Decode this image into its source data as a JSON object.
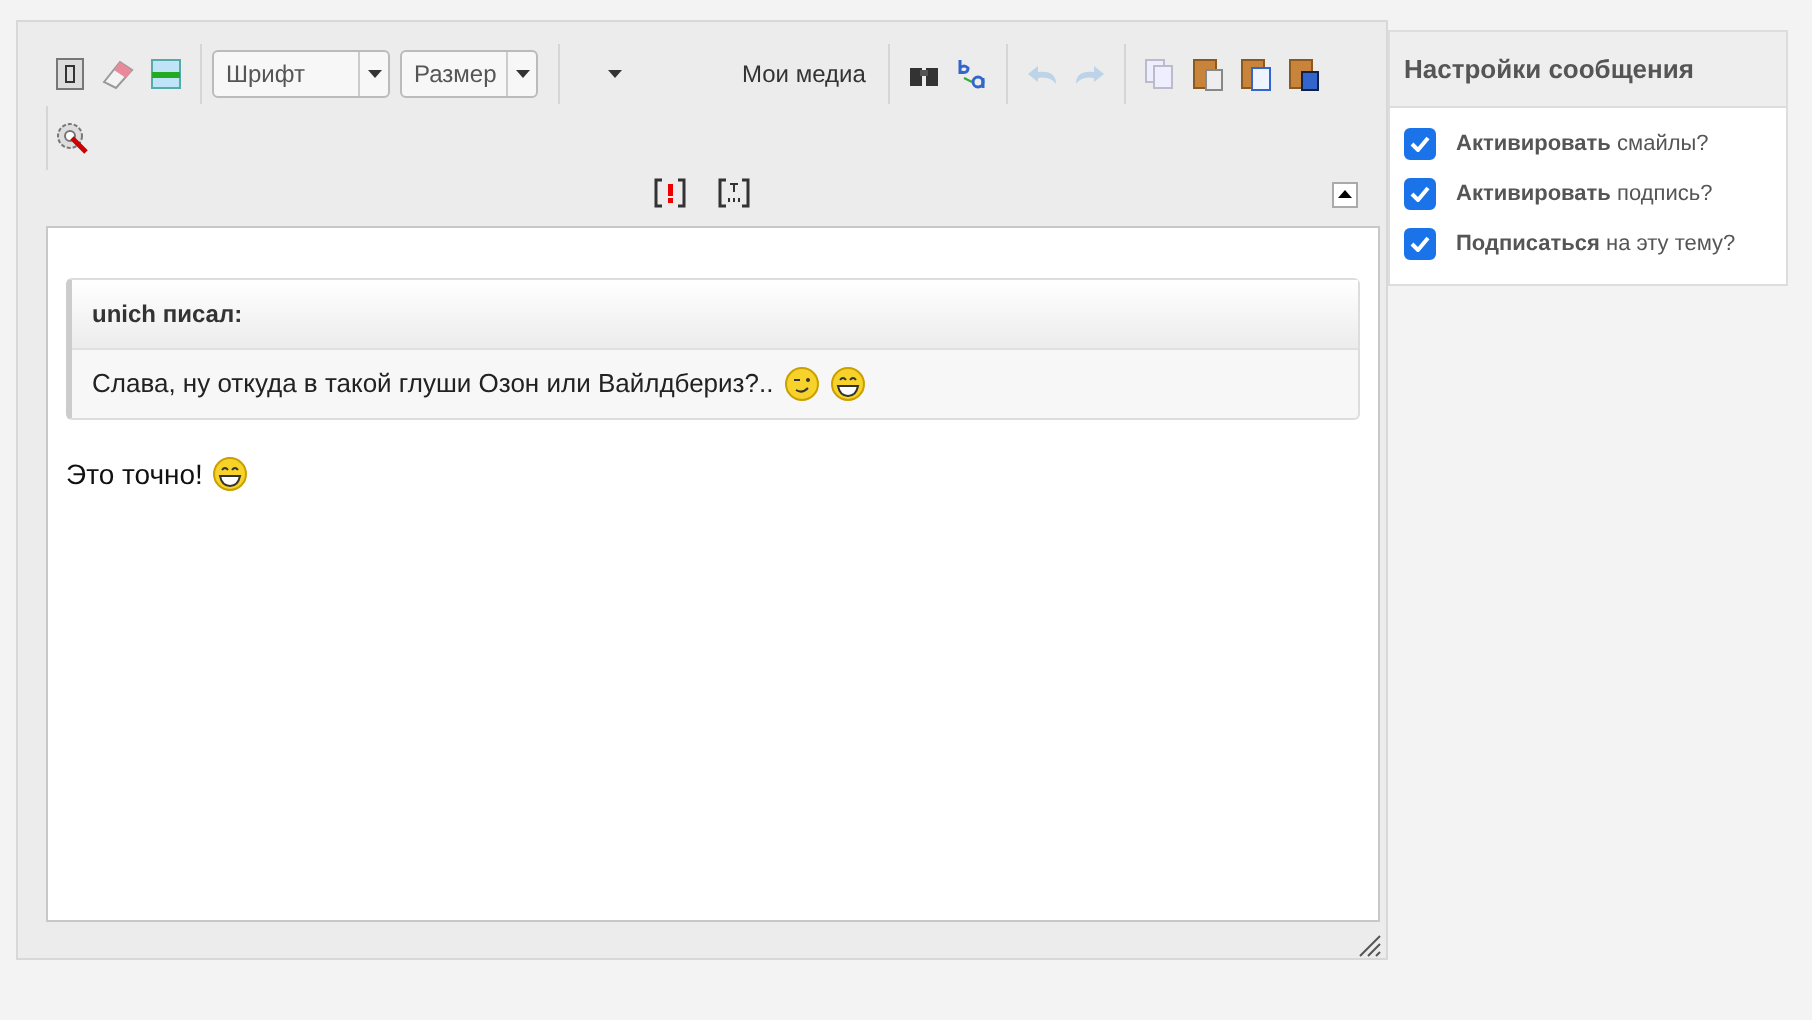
{
  "toolbar": {
    "font_select": {
      "placeholder": "Шрифт"
    },
    "size_select": {
      "placeholder": "Размер"
    },
    "media_button": "Мои медиа"
  },
  "editor": {
    "quote": {
      "author": "unich писал:",
      "text": "Слава, ну откуда в такой глуши Озон или Вайлдбериз?..",
      "smileys": [
        {
          "kind": "wink"
        },
        {
          "kind": "grin"
        }
      ]
    },
    "reply": {
      "text": "Это точно!",
      "smileys": [
        {
          "kind": "grin"
        }
      ]
    }
  },
  "sidebar": {
    "title": "Настройки сообщения",
    "options": [
      {
        "label": "**Активировать** смайлы?",
        "checked": true
      },
      {
        "label": "**Активировать** подпись?",
        "checked": true
      },
      {
        "label": "**Подписаться** на эту тему?",
        "checked": true
      }
    ]
  }
}
